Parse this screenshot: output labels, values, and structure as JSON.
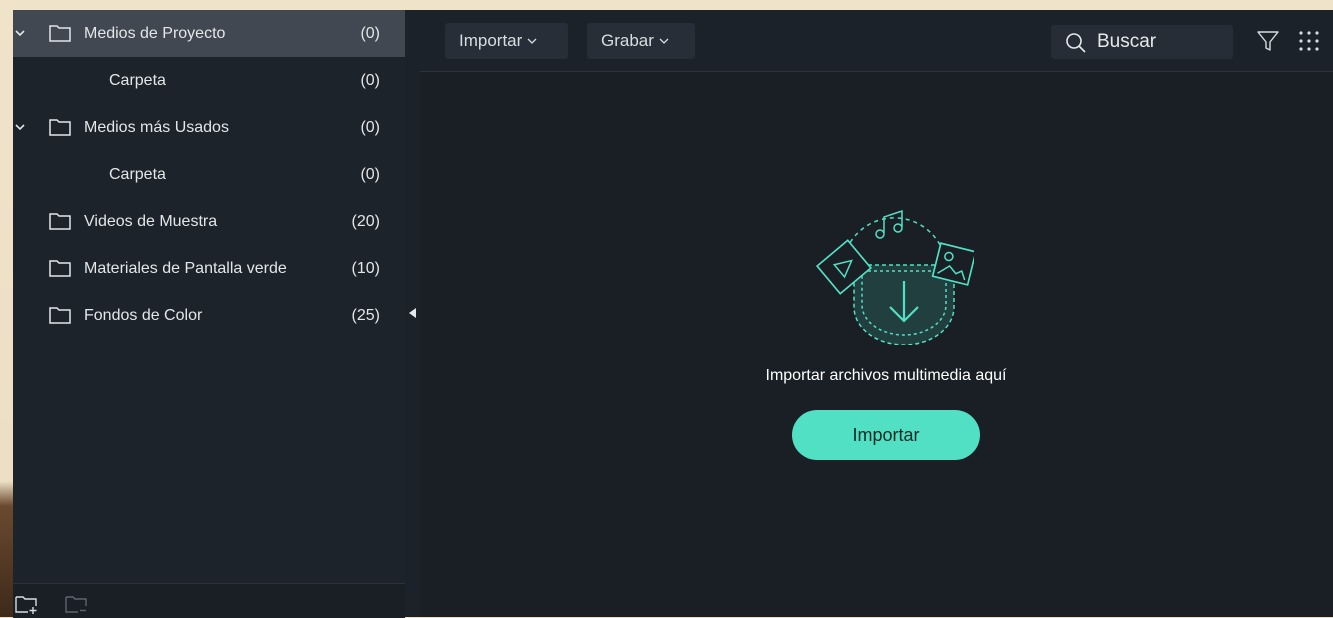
{
  "sidebar": {
    "items": [
      {
        "label": "Medios de Proyecto",
        "count": "(0)"
      },
      {
        "label": "Carpeta",
        "count": "(0)"
      },
      {
        "label": "Medios más Usados",
        "count": "(0)"
      },
      {
        "label": "Carpeta",
        "count": "(0)"
      },
      {
        "label": "Videos de Muestra",
        "count": "(20)"
      },
      {
        "label": "Materiales de Pantalla verde",
        "count": "(10)"
      },
      {
        "label": "Fondos de Color",
        "count": "(25)"
      }
    ]
  },
  "toolbar": {
    "import_label": "Importar",
    "record_label": "Grabar",
    "search_placeholder": "Buscar"
  },
  "empty_state": {
    "message": "Importar archivos multimedia aquí",
    "button_label": "Importar"
  },
  "colors": {
    "accent": "#52e0c4",
    "sidebar_bg": "#1d232b",
    "selected_row": "#414852",
    "main_bg": "#1a1f26"
  }
}
